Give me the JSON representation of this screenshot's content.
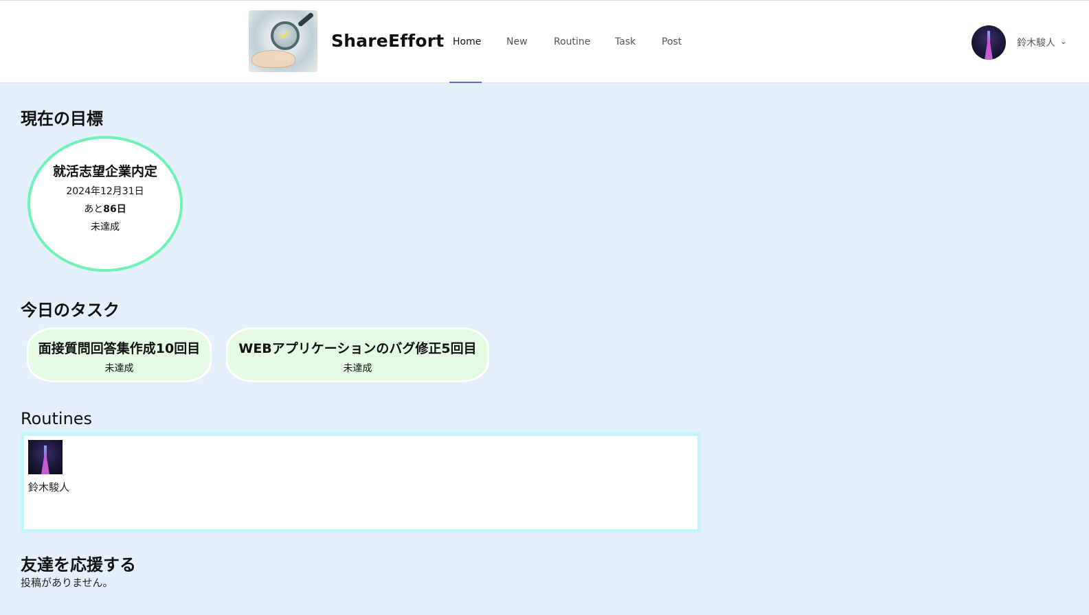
{
  "header": {
    "brand": "ShareEffort",
    "logo_icon": "magnifier-hand-icon",
    "nav": [
      {
        "label": "Home",
        "active": true
      },
      {
        "label": "New",
        "active": false
      },
      {
        "label": "Routine",
        "active": false
      },
      {
        "label": "Task",
        "active": false
      },
      {
        "label": "Post",
        "active": false
      }
    ],
    "user": {
      "name": "鈴木駿人",
      "menu_icon": "chevron-down-icon"
    }
  },
  "goal_section": {
    "heading": "現在の目標",
    "goal": {
      "title": "就活志望企業内定",
      "date": "2024年12月31日",
      "remaining_prefix": "あと",
      "remaining_days": "86日",
      "status": "未達成"
    }
  },
  "tasks_section": {
    "heading": "今日のタスク",
    "tasks": [
      {
        "title": "面接質問回答集作成10回目",
        "status": "未達成"
      },
      {
        "title": "WEBアプリケーションのバグ修正5回目",
        "status": "未達成"
      }
    ]
  },
  "routines_section": {
    "heading": "Routines",
    "items": [
      {
        "user": "鈴木駿人"
      }
    ]
  },
  "support_section": {
    "heading": "友達を応援する",
    "empty_text": "投稿がありません。"
  },
  "colors": {
    "page_bg": "#e4f1fd",
    "goal_border": "#6ef3b4",
    "task_bg": "#e2fbe2",
    "routines_border": "#c4f7fb",
    "nav_active": "#5c6ad8"
  }
}
